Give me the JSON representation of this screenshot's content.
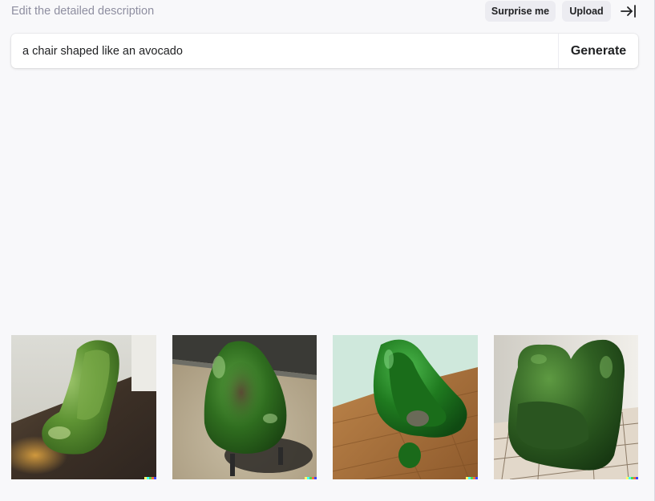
{
  "header": {
    "label": "Edit the detailed description",
    "surprise_label": "Surprise me",
    "upload_label": "Upload",
    "collapse_icon": "arrow-right-to-bar-icon"
  },
  "prompt": {
    "value": "a chair shaped like an avocado",
    "generate_label": "Generate"
  },
  "results": [
    {
      "name": "avocado-chair-image-1",
      "colors": [
        "#5a8f2e",
        "#d8d8d0",
        "#4a3a2a"
      ]
    },
    {
      "name": "avocado-chair-image-2",
      "colors": [
        "#2f6d1f",
        "#b5a88f",
        "#3a3a36"
      ]
    },
    {
      "name": "avocado-chair-image-3",
      "colors": [
        "#1f7a1f",
        "#c8e8d8",
        "#a8743e"
      ]
    },
    {
      "name": "avocado-chair-image-4",
      "colors": [
        "#2f5f22",
        "#e8e6e0",
        "#d8d0c4"
      ]
    }
  ],
  "signature_colors": [
    "#ffff66",
    "#42ffff",
    "#51da4c",
    "#ff6e3c",
    "#3c46ff"
  ],
  "colors": {
    "background": "#f8f8fa",
    "pill": "#ececf1",
    "muted_text": "#8e8ea0",
    "text": "#202123"
  }
}
